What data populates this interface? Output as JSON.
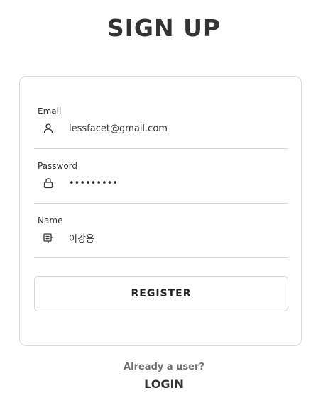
{
  "page": {
    "title": "SIGN UP"
  },
  "form": {
    "email": {
      "label": "Email",
      "value": "lessfacet@gmail.com",
      "icon": "user-icon"
    },
    "password": {
      "label": "Password",
      "value": "secret123",
      "icon": "lock-icon"
    },
    "name": {
      "label": "Name",
      "value": "이강용",
      "icon": "id-card-icon"
    },
    "register_label": "REGISTER"
  },
  "footer": {
    "prompt": "Already a user?",
    "login_label": "LOGIN"
  },
  "colors": {
    "text": "#333333",
    "muted": "#6f6f6f",
    "border": "#dcdcdc",
    "background": "#ffffff"
  }
}
